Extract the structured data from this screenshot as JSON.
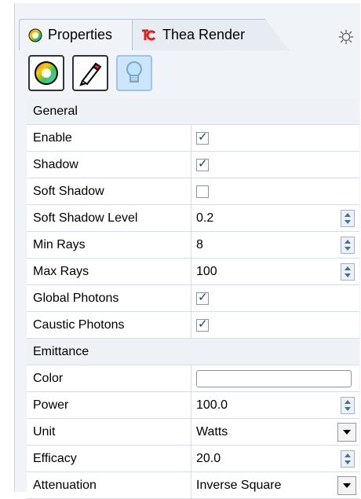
{
  "tabs": [
    {
      "label": "Properties",
      "icon": "color-circle-icon",
      "active": true
    },
    {
      "label": "Thea Render",
      "icon": "thea-logo-icon",
      "active": false
    }
  ],
  "toolbar": {
    "buttons": [
      {
        "name": "material-button",
        "icon": "color-wheel-icon"
      },
      {
        "name": "tool-button",
        "icon": "brush-icon"
      },
      {
        "name": "light-button",
        "icon": "lightbulb-icon",
        "selected": true
      }
    ]
  },
  "sections": {
    "general": {
      "title": "General",
      "rows": [
        {
          "label": "Enable",
          "type": "checkbox",
          "checked": true
        },
        {
          "label": "Shadow",
          "type": "checkbox",
          "checked": true
        },
        {
          "label": "Soft Shadow",
          "type": "checkbox",
          "checked": false
        },
        {
          "label": "Soft Shadow Level",
          "type": "spinner",
          "value": "0.2"
        },
        {
          "label": "Min Rays",
          "type": "spinner",
          "value": "8"
        },
        {
          "label": "Max Rays",
          "type": "spinner",
          "value": "100"
        },
        {
          "label": "Global Photons",
          "type": "checkbox",
          "checked": true
        },
        {
          "label": "Caustic Photons",
          "type": "checkbox",
          "checked": true
        }
      ]
    },
    "emittance": {
      "title": "Emittance",
      "rows": [
        {
          "label": "Color",
          "type": "color",
          "value": "#ffffff"
        },
        {
          "label": "Power",
          "type": "spinner",
          "value": "100.0"
        },
        {
          "label": "Unit",
          "type": "select",
          "value": "Watts"
        },
        {
          "label": "Efficacy",
          "type": "spinner",
          "value": "20.0"
        },
        {
          "label": "Attenuation",
          "type": "select",
          "value": "Inverse Square"
        }
      ]
    }
  },
  "colors": {
    "accent": "#cde6fb",
    "panel": "#f0f4f9"
  }
}
